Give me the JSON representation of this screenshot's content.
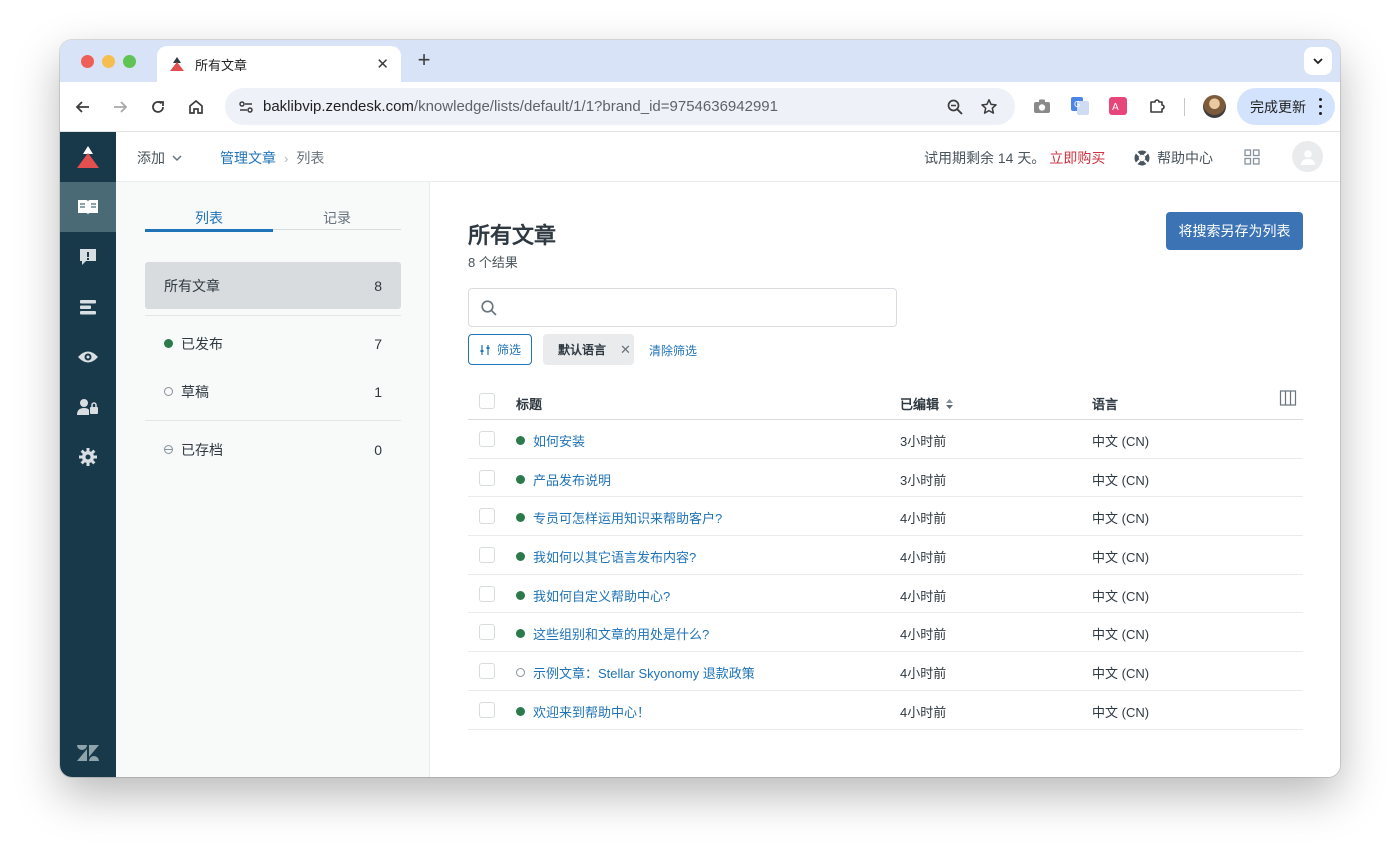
{
  "browser": {
    "tab_title": "所有文章",
    "url_host": "baklibvip.zendesk.com",
    "url_path": "/knowledge/lists/default/1/1?brand_id=9754636942991",
    "update_label": "完成更新"
  },
  "topbar": {
    "add_label": "添加",
    "breadcrumb": {
      "parent": "管理文章",
      "current": "列表"
    },
    "trial_text": "试用期剩余 14 天。",
    "buy_label": "立即购买",
    "help_center_label": "帮助中心"
  },
  "sidepanel": {
    "tabs": [
      {
        "label": "列表",
        "active": true
      },
      {
        "label": "记录",
        "active": false
      }
    ],
    "all": {
      "label": "所有文章",
      "count": "8"
    },
    "published": {
      "label": "已发布",
      "count": "7"
    },
    "draft": {
      "label": "草稿",
      "count": "1"
    },
    "archived": {
      "label": "已存档",
      "count": "0"
    }
  },
  "main": {
    "title": "所有文章",
    "result_count": "8 个结果",
    "save_search_label": "将搜索另存为列表",
    "search_value": "",
    "filter_label": "筛选",
    "chip_label": "默认语言",
    "clear_label": "清除筛选",
    "columns": {
      "title": "标题",
      "edited": "已编辑",
      "language": "语言"
    },
    "rows": [
      {
        "title": "如何安装",
        "edited": "3小时前",
        "language": "中文 (CN)",
        "status": "published"
      },
      {
        "title": "产品发布说明",
        "edited": "3小时前",
        "language": "中文 (CN)",
        "status": "published"
      },
      {
        "title": "专员可怎样运用知识来帮助客户?",
        "edited": "4小时前",
        "language": "中文 (CN)",
        "status": "published"
      },
      {
        "title": "我如何以其它语言发布内容?",
        "edited": "4小时前",
        "language": "中文 (CN)",
        "status": "published"
      },
      {
        "title": "我如何自定义帮助中心?",
        "edited": "4小时前",
        "language": "中文 (CN)",
        "status": "published"
      },
      {
        "title": "这些组别和文章的用处是什么?",
        "edited": "4小时前",
        "language": "中文 (CN)",
        "status": "published"
      },
      {
        "title": "示例文章：Stellar Skyonomy 退款政策",
        "edited": "4小时前",
        "language": "中文 (CN)",
        "status": "draft"
      },
      {
        "title": "欢迎来到帮助中心！",
        "edited": "4小时前",
        "language": "中文 (CN)",
        "status": "published"
      }
    ]
  },
  "colors": {
    "nav_bg": "#17394a",
    "nav_active": "#4a6b76",
    "link": "#1f73b7",
    "primary_button": "#3b73b5",
    "buy_red": "#cc3340",
    "published_green": "#2b7a4b"
  }
}
